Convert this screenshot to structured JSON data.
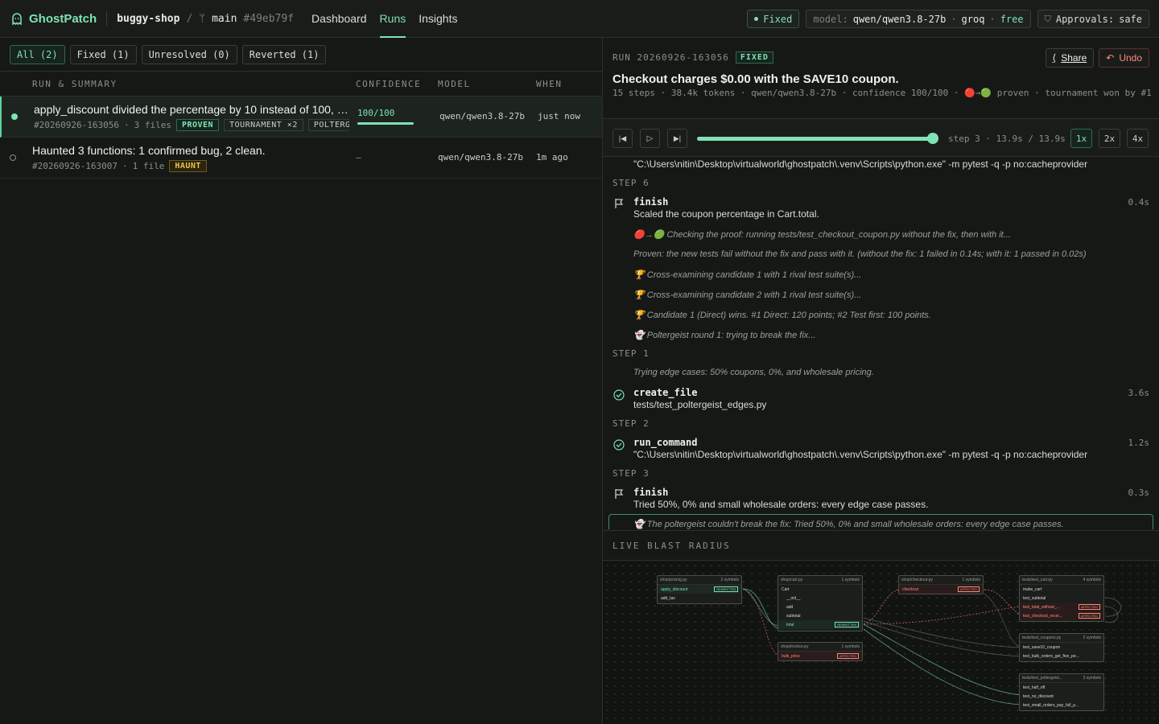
{
  "app": {
    "brand": "GhostPatch",
    "repo": "buggy-shop",
    "branch": "main",
    "sha": "#49eb79f"
  },
  "nav": [
    "Dashboard",
    "Runs",
    "Insights"
  ],
  "status": {
    "fixed": "Fixed",
    "model_label": "model:",
    "model_value": "qwen/qwen3.8-27b",
    "provider": "groq",
    "tier": "free",
    "approvals_label": "Approvals:",
    "approvals_value": "safe"
  },
  "filters": [
    "All (2)",
    "Fixed (1)",
    "Unresolved (0)",
    "Reverted (1)"
  ],
  "table": {
    "headers": [
      "RUN & SUMMARY",
      "CONFIDENCE",
      "MODEL",
      "WHEN"
    ],
    "rows": [
      {
        "title": "apply_discount divided the percentage by 10 instead of 100, so...",
        "id": "#20260926-163056",
        "files": "3 files",
        "tags": [
          "PROVEN",
          "TOURNAMENT ×2",
          "POLTERG"
        ],
        "confidence": "100/100",
        "confidence_value": 1.0,
        "model": "qwen/qwen3.8-27b",
        "when": "just now"
      },
      {
        "title": "Haunted 3 functions: 1 confirmed bug, 2 clean.",
        "id": "#20260926-163007",
        "files": "1 file",
        "tags": [
          "HAUNT"
        ],
        "confidence": "—",
        "model": "qwen/qwen3.8-27b",
        "when": "1m ago"
      }
    ]
  },
  "run": {
    "label": "RUN 20260926-163056",
    "status": "FIXED",
    "share": "Share",
    "undo": "Undo",
    "title": "Checkout charges $0.00 with the SAVE10 coupon.",
    "meta": "15 steps · 38.4k tokens · qwen/qwen3.8-27b · confidence 100/100 · 🔴→🟢 proven · tournament won by #1"
  },
  "player": {
    "progress": 1.0,
    "step_info": "step 3 · 13.9s / 13.9s",
    "speeds": [
      "1x",
      "2x",
      "4x"
    ],
    "active_speed": "1x"
  },
  "timeline": {
    "top_cmd": "\"C:\\Users\\nitin\\Desktop\\virtualworld\\ghostpatch\\.venv\\Scripts\\python.exe\" -m pytest -q -p no:cacheprovider",
    "step6": "STEP 6",
    "finish1_name": "finish",
    "finish1_desc": "Scaled the coupon percentage in Cart.total.",
    "finish1_dur": "0.4s",
    "note1": "🔴→🟢 Checking the proof: running tests/test_checkout_coupon.py without the fix, then with it...",
    "note2": "Proven: the new tests fail without the fix and pass with it. (without the fix: 1 failed in 0.14s; with it: 1 passed in 0.02s)",
    "note3": "🏆 Cross-examining candidate 1 with 1 rival test suite(s)...",
    "note4": "🏆 Cross-examining candidate 2 with 1 rival test suite(s)...",
    "note5": "🏆 Candidate 1 (Direct) wins. #1 Direct: 120 points; #2 Test first: 100 points.",
    "note6": "👻 Poltergeist round 1: trying to break the fix...",
    "step1": "STEP 1",
    "note7": "Trying edge cases: 50% coupons, 0%, and wholesale pricing.",
    "create_name": "create_file",
    "create_desc": "tests/test_poltergeist_edges.py",
    "create_dur": "3.6s",
    "step2": "STEP 2",
    "run_name": "run_command",
    "run_desc": "\"C:\\Users\\nitin\\Desktop\\virtualworld\\ghostpatch\\.venv\\Scripts\\python.exe\" -m pytest -q -p no:cacheprovider",
    "run_dur": "1.2s",
    "step3": "STEP 3",
    "finish2_name": "finish",
    "finish2_desc": "Tried 50%, 0% and small wholesale orders: every edge case passes.",
    "finish2_dur": "0.3s",
    "note8": "👻 The poltergeist couldn't break the fix: Tried 50%, 0% and small wholesale orders: every edge case passes."
  },
  "blast": {
    "title": "LIVE BLAST RADIUS",
    "nodes": [
      {
        "file": "shop/pricing.py",
        "count": "2 symbols",
        "items": [
          {
            "name": "apply_discount",
            "badge": "REWRITTEN",
            "state": "rewritten"
          },
          {
            "name": "add_tax",
            "badge": "",
            "state": ""
          }
        ]
      },
      {
        "file": "shop/cart.py",
        "count": "1 symbols",
        "items": [
          {
            "name": "Cart",
            "badge": "",
            "state": ""
          },
          {
            "name": "__init__",
            "badge": "",
            "state": ""
          },
          {
            "name": "add",
            "badge": "",
            "state": ""
          },
          {
            "name": "subtotal",
            "badge": "",
            "state": ""
          },
          {
            "name": "total",
            "badge": "REWRITTEN",
            "state": "rewritten"
          }
        ]
      },
      {
        "file": "shop/checkout.py",
        "count": "1 symbols",
        "items": [
          {
            "name": "checkout",
            "badge": "AFFECTED",
            "state": "affected"
          }
        ]
      },
      {
        "file": "tests/test_cart.py",
        "count": "4 symbols",
        "items": [
          {
            "name": "make_cart",
            "badge": "",
            "state": ""
          },
          {
            "name": "test_subtotal",
            "badge": "",
            "state": ""
          },
          {
            "name": "test_total_without_...",
            "badge": "AFFECTED",
            "state": "affected"
          },
          {
            "name": "test_checkout_recei...",
            "badge": "AFFECTED",
            "state": "affected"
          }
        ]
      },
      {
        "file": "shop/invoice.py",
        "count": "1 symbols",
        "items": [
          {
            "name": "bulk_price",
            "badge": "AFFECTED",
            "state": "affected"
          }
        ]
      },
      {
        "file": "tests/test_coupons.py",
        "count": "2 symbols",
        "items": [
          {
            "name": "test_save10_coupon",
            "badge": "",
            "state": ""
          },
          {
            "name": "test_bulk_orders_get_five_pe...",
            "badge": "",
            "state": ""
          }
        ]
      },
      {
        "file": "tests/test_poltergeist...",
        "count": "3 symbols",
        "items": [
          {
            "name": "test_half_off",
            "badge": "",
            "state": ""
          },
          {
            "name": "test_no_discount",
            "badge": "",
            "state": ""
          },
          {
            "name": "test_small_orders_pay_full_p...",
            "badge": "",
            "state": ""
          }
        ]
      }
    ]
  },
  "colors": {
    "accent": "#7fe3b4",
    "affected": "#ff8a7a",
    "haunt": "#f0c44c",
    "bg": "#161816"
  }
}
